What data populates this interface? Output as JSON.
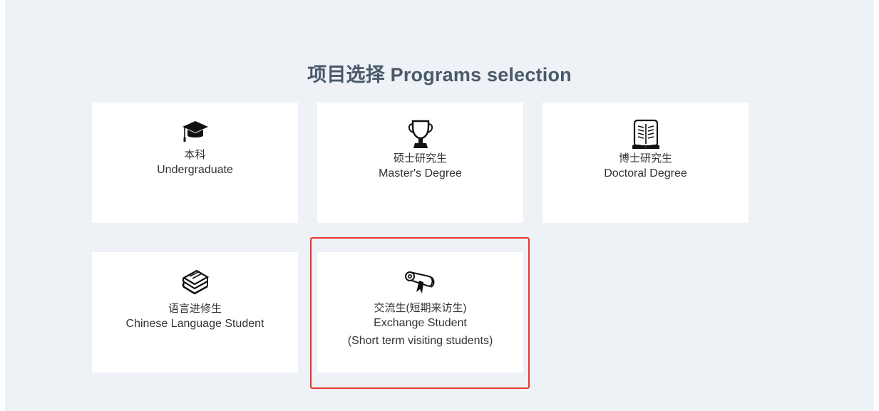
{
  "section": {
    "title": "项目选择 Programs selection"
  },
  "programs": [
    {
      "cn": "本科",
      "en": "Undergraduate",
      "icon": "graduation-cap-icon"
    },
    {
      "cn": "硕士研究生",
      "en": "Master's Degree",
      "icon": "trophy-icon"
    },
    {
      "cn": "博士研究生",
      "en": "Doctoral Degree",
      "icon": "open-book-icon"
    },
    {
      "cn": "语言进修生",
      "en": "Chinese Language Student",
      "icon": "books-stack-icon"
    },
    {
      "cn": "交流生(短期来访生)",
      "en": "Exchange Student",
      "en2": "(Short term visiting students)",
      "icon": "diploma-scroll-icon"
    }
  ],
  "colors": {
    "background": "#eef1f5",
    "card": "#ffffff",
    "title": "#4a5a6b",
    "highlight": "#e8362c"
  }
}
